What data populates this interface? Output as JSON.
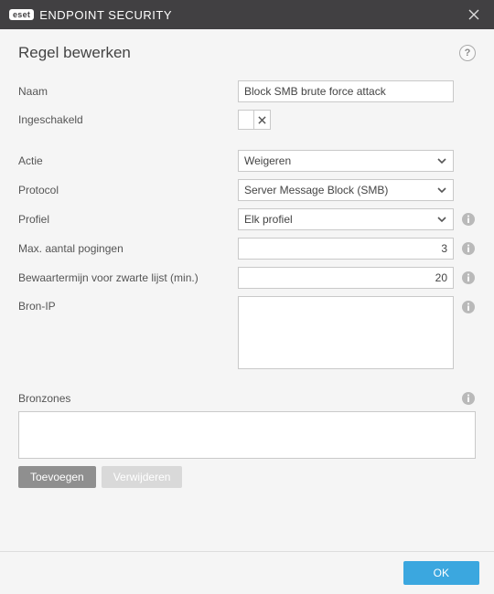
{
  "titlebar": {
    "brand_badge": "eset",
    "product_name": "ENDPOINT SECURITY"
  },
  "header": {
    "title": "Regel bewerken",
    "help_tooltip": "?"
  },
  "fields": {
    "name": {
      "label": "Naam",
      "value": "Block SMB brute force attack"
    },
    "enabled": {
      "label": "Ingeschakeld",
      "value": false
    },
    "action": {
      "label": "Actie",
      "value": "Weigeren"
    },
    "protocol": {
      "label": "Protocol",
      "value": "Server Message Block (SMB)"
    },
    "profile": {
      "label": "Profiel",
      "value": "Elk profiel"
    },
    "max_attempts": {
      "label": "Max. aantal pogingen",
      "value": "3"
    },
    "blacklist_ttl": {
      "label": "Bewaartermijn voor zwarte lijst (min.)",
      "value": "20"
    },
    "source_ip": {
      "label": "Bron-IP",
      "value": ""
    },
    "source_zones": {
      "label": "Bronzones",
      "value": ""
    }
  },
  "buttons": {
    "add": "Toevoegen",
    "remove": "Verwijderen",
    "ok": "OK"
  }
}
